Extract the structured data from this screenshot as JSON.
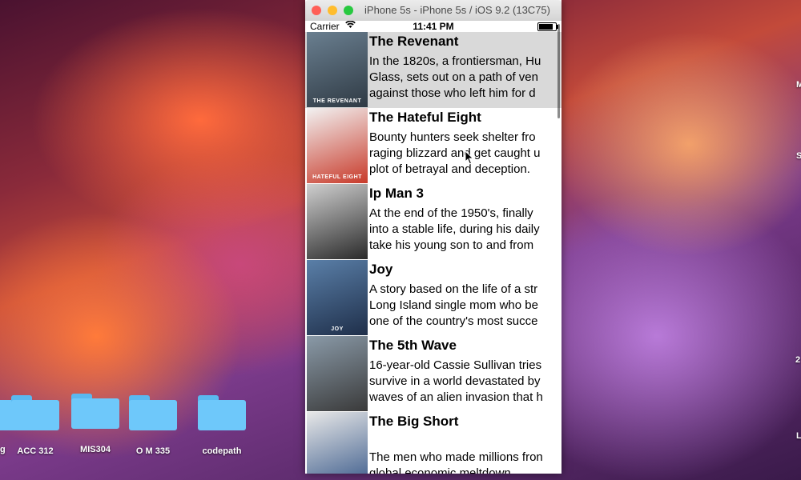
{
  "window": {
    "title": "iPhone 5s - iPhone 5s / iOS 9.2 (13C75)"
  },
  "statusbar": {
    "carrier": "Carrier",
    "time": "11:41 PM",
    "battery_level": 0.9
  },
  "movies": [
    {
      "title": "The Revenant",
      "synopsis": [
        "In the 1820s, a frontiersman, Hu",
        "Glass, sets out on a path of ven",
        "against those who left him for d"
      ],
      "poster_caption": "THE REVENANT",
      "poster_colors": [
        "#6a7f90",
        "#2f3a44"
      ],
      "selected": true
    },
    {
      "title": "The Hateful Eight",
      "synopsis": [
        "Bounty hunters seek shelter fro",
        "raging blizzard and get caught u",
        "plot of betrayal and deception."
      ],
      "poster_caption": "HATEFUL EIGHT",
      "poster_colors": [
        "#f2f2f2",
        "#c83a2a"
      ],
      "selected": false
    },
    {
      "title": "Ip Man 3",
      "synopsis": [
        "At the end of the 1950's, finally",
        "into a stable life, during his daily",
        "take his young son to and from"
      ],
      "poster_caption": "",
      "poster_colors": [
        "#cfcfcf",
        "#2a2a2a"
      ],
      "selected": false
    },
    {
      "title": "Joy",
      "synopsis": [
        "A story based on the life of a str",
        "Long Island single mom who be",
        "one of the country's most succe"
      ],
      "poster_caption": "JOY",
      "poster_colors": [
        "#5a7fa8",
        "#1f2f4a"
      ],
      "selected": false
    },
    {
      "title": "The 5th Wave",
      "synopsis": [
        "16-year-old Cassie Sullivan tries",
        "survive in a world devastated by",
        "waves of an alien invasion that h"
      ],
      "poster_caption": "",
      "poster_colors": [
        "#8a9aa8",
        "#3a3a3a"
      ],
      "selected": false
    },
    {
      "title": "The Big Short",
      "synopsis": [
        "",
        "The men who made millions fron",
        "global economic meltdown."
      ],
      "poster_caption": "",
      "poster_colors": [
        "#e8e8e8",
        "#3a5a8a"
      ],
      "selected": false
    }
  ],
  "desktop": {
    "folders": [
      {
        "label": "ACC 312"
      },
      {
        "label": "MIS304"
      },
      {
        "label": "O M 335"
      },
      {
        "label": "codepath"
      }
    ],
    "edge_labels": [
      "M",
      "S",
      "2",
      "L",
      "g"
    ]
  }
}
